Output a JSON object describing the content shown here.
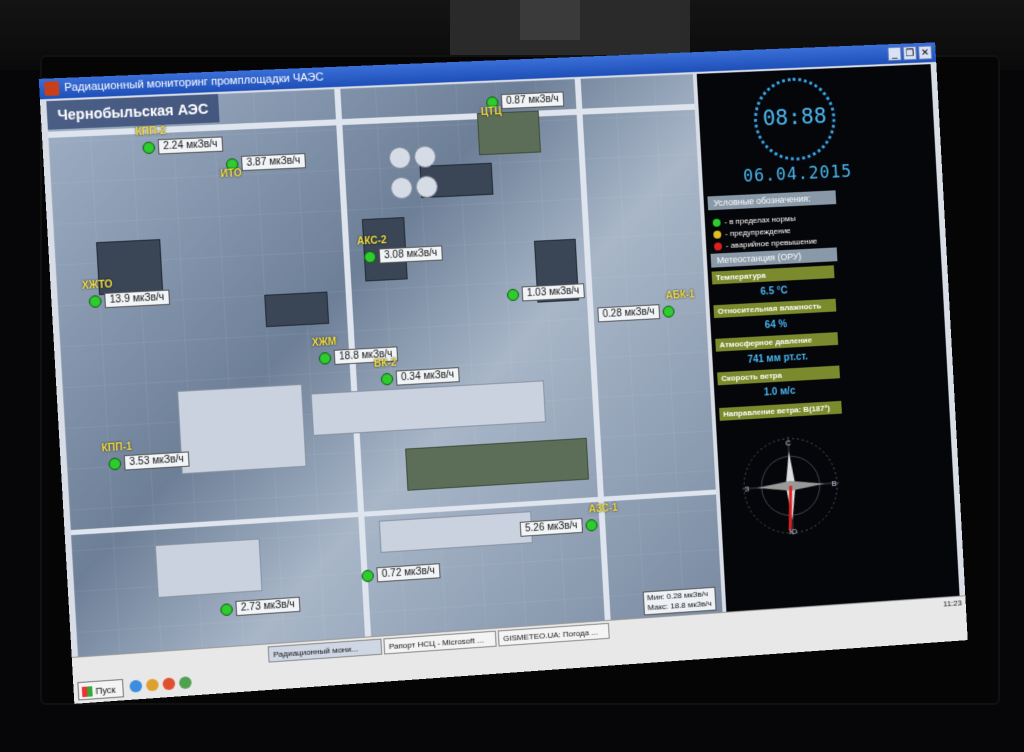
{
  "window": {
    "title": "Радиационный мониторинг промплощадки ЧАЭС",
    "buttons": [
      "_",
      "❐",
      "✕"
    ]
  },
  "map": {
    "title": "Чернобыльская АЭС",
    "sensors": [
      {
        "name": "КПП-2",
        "value": "2.24 мкЗв/ч",
        "status": "norm"
      },
      {
        "name": "ИТО",
        "value": "3.87 мкЗв/ч",
        "status": "norm"
      },
      {
        "name": "ЦТЦ",
        "value": "0.87 мкЗв/ч",
        "status": "norm"
      },
      {
        "name": "АКС-2",
        "value": "3.08 мкЗв/ч",
        "status": "norm"
      },
      {
        "name": "ХЖТО",
        "value": "13.9 мкЗв/ч",
        "status": "norm"
      },
      {
        "name": "",
        "value": "1.03 мкЗв/ч",
        "status": "norm"
      },
      {
        "name": "АБК-1",
        "value": "0.28 мкЗв/ч",
        "status": "norm"
      },
      {
        "name": "ХЖМ",
        "value": "18.8 мкЗв/ч",
        "status": "norm"
      },
      {
        "name": "ВК-2",
        "value": "0.34 мкЗв/ч",
        "status": "norm"
      },
      {
        "name": "КПП-1",
        "value": "3.53 мкЗв/ч",
        "status": "norm"
      },
      {
        "name": "АЗС-1",
        "value": "5.26 мкЗв/ч",
        "status": "norm"
      },
      {
        "name": "",
        "value": "0.72 мкЗв/ч",
        "status": "norm"
      },
      {
        "name": "",
        "value": "2.73 мкЗв/ч",
        "status": "norm"
      }
    ],
    "minmax": {
      "min": "Мин: 0.28 мкЗв/ч",
      "max": "Макс: 18.8 мкЗв/ч"
    }
  },
  "side": {
    "time": "08:88",
    "date": "06.04.2015",
    "legend_title": "Условные обозначения:",
    "legend": [
      {
        "label": "- в пределах нормы",
        "color": "#2ecc2e"
      },
      {
        "label": "- предупреждение",
        "color": "#e0c020"
      },
      {
        "label": "- аварийное превышение",
        "color": "#e02020"
      }
    ],
    "meteo_title": "Метеостанция (ОРУ)",
    "meteo": [
      {
        "label": "Температура",
        "value": "6.5 °C"
      },
      {
        "label": "Относительная влажность",
        "value": "64 %"
      },
      {
        "label": "Атмосферное давление",
        "value": "741 мм рт.ст."
      },
      {
        "label": "Скорость ветра",
        "value": "1.0 м/с"
      }
    ],
    "wind_direction": "Направление ветра: В(187°)",
    "compass_points": [
      "С",
      "В",
      "Ю",
      "З"
    ]
  },
  "taskbar": {
    "start": "Пуск",
    "apps": [
      {
        "label": "Радиационный мони...",
        "active": true
      },
      {
        "label": "Рапорт НСЦ - Microsoft ...",
        "active": false
      },
      {
        "label": "GISMETEO.UA: Погода ...",
        "active": false
      }
    ],
    "tray_time": "11:23"
  }
}
